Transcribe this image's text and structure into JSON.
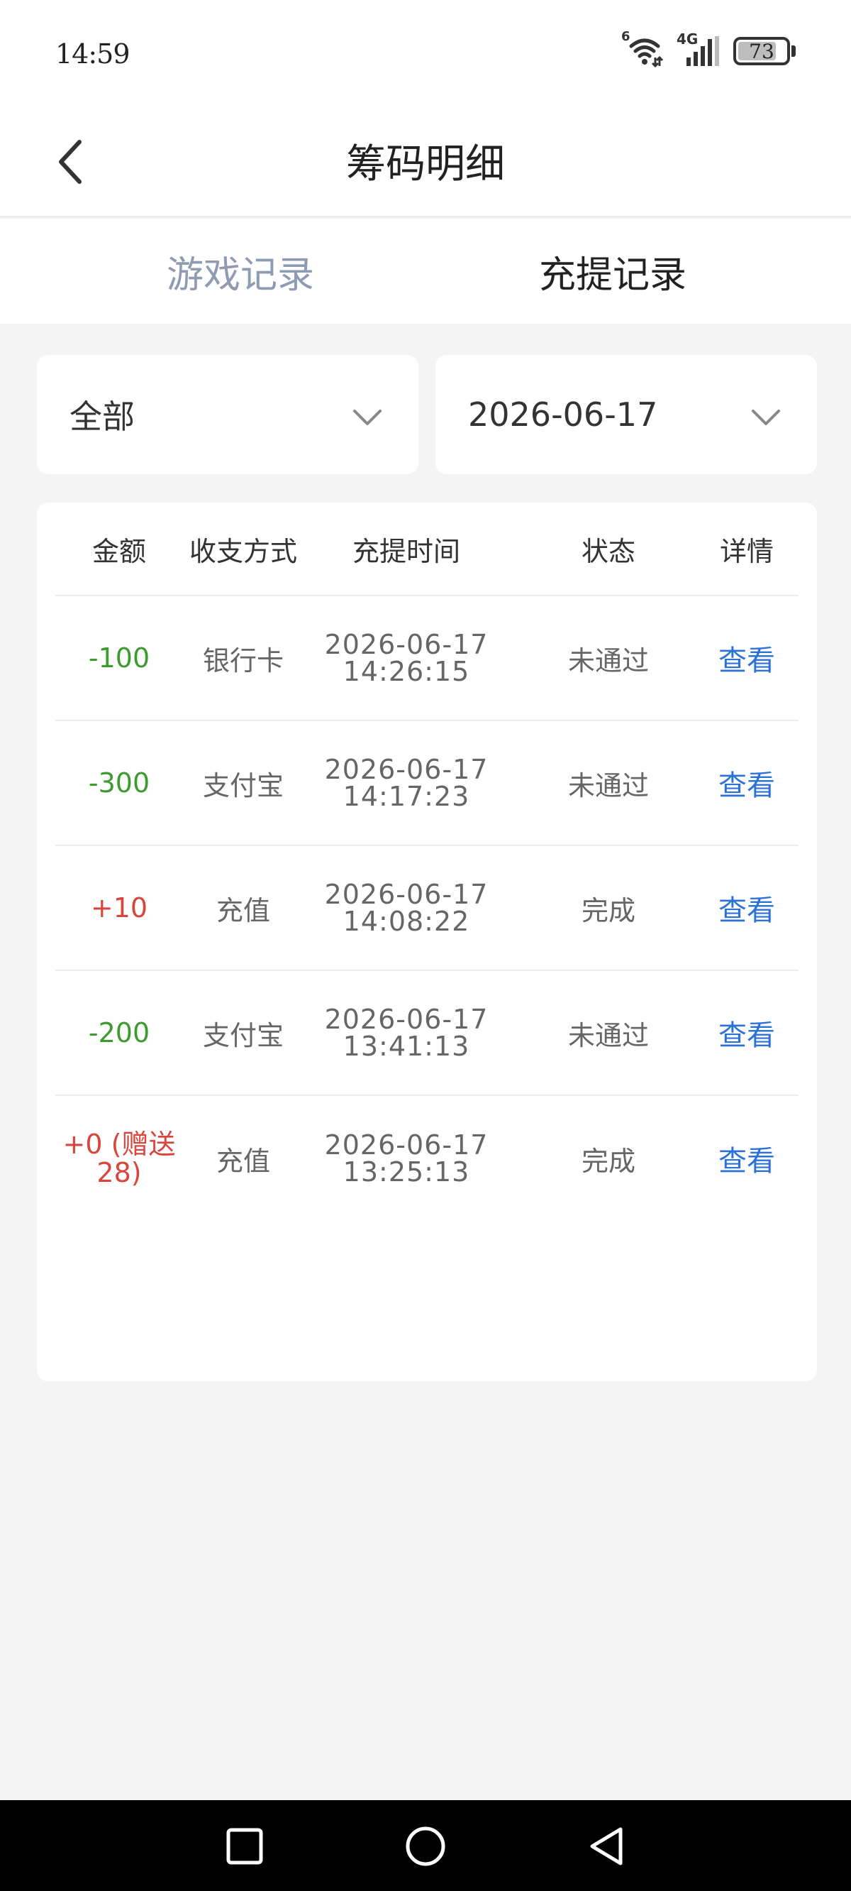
{
  "status_bar": {
    "time": "14:59",
    "battery_level": "73",
    "network": "4G",
    "wifi_label": "6",
    "icons": [
      "wifi-icon",
      "signal-icon",
      "battery-icon"
    ]
  },
  "header": {
    "title": "筹码明细",
    "back_icon": "chevron-left-icon"
  },
  "tabs": [
    {
      "label": "游戏记录",
      "active": false
    },
    {
      "label": "充提记录",
      "active": true
    }
  ],
  "filters": {
    "type": {
      "value": "全部",
      "icon": "chevron-down-icon"
    },
    "date": {
      "value": "2026-06-17",
      "icon": "chevron-down-icon"
    }
  },
  "table": {
    "headers": [
      "金额",
      "收支方式",
      "充提时间",
      "状态",
      "详情"
    ],
    "rows": [
      {
        "amount": "-100",
        "method": "银行卡",
        "date": "2026-06-17",
        "time": "14:26:15",
        "status": "未通过",
        "detail": "查看"
      },
      {
        "amount": "-300",
        "method": "支付宝",
        "date": "2026-06-17",
        "time": "14:17:23",
        "status": "未通过",
        "detail": "查看"
      },
      {
        "amount": "+10",
        "method": "充值",
        "date": "2026-06-17",
        "time": "14:08:22",
        "status": "完成",
        "detail": "查看"
      },
      {
        "amount": "-200",
        "method": "支付宝",
        "date": "2026-06-17",
        "time": "13:41:13",
        "status": "未通过",
        "detail": "查看"
      },
      {
        "amount_line1": "+0 (赠送",
        "amount_line2": "28)",
        "method": "充值",
        "date": "2026-06-17",
        "time": "13:25:13",
        "status": "完成",
        "detail": "查看"
      }
    ]
  },
  "colors": {
    "negative": "#3d9a2f",
    "positive": "#d9453c",
    "link": "#2c72d6",
    "inactive_tab": "#8f9bb3"
  },
  "nav_bar": {
    "icons": [
      "square-recents-icon",
      "circle-home-icon",
      "triangle-back-icon"
    ]
  }
}
